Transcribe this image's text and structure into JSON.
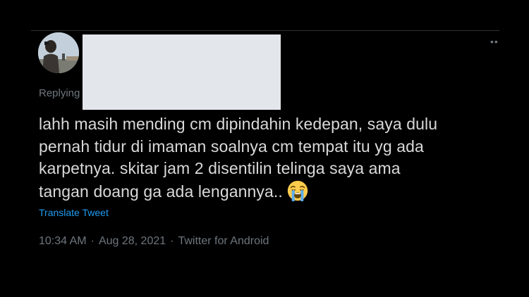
{
  "tweet": {
    "replying_label": "Replying",
    "text_lines": [
      "lahh masih mending cm dipindahin kedepan, saya dulu",
      "pernah tidur di imaman soalnya cm tempat itu yg ada",
      "karpetnya. skitar jam 2 disentilin telinga saya ama",
      "tangan doang ga ada lengannya.."
    ],
    "emoji_icon": "loudly-crying-face-icon",
    "translate_label": "Translate Tweet",
    "time": "10:34 AM",
    "date": "Aug 28, 2021",
    "source": "Twitter for Android",
    "separator": "·",
    "more_icon_glyph": "••"
  },
  "colors": {
    "background": "#000000",
    "text": "#d9d9d9",
    "muted": "#6e767d",
    "link": "#1d9bf0",
    "redaction": "#e3e6ea"
  }
}
